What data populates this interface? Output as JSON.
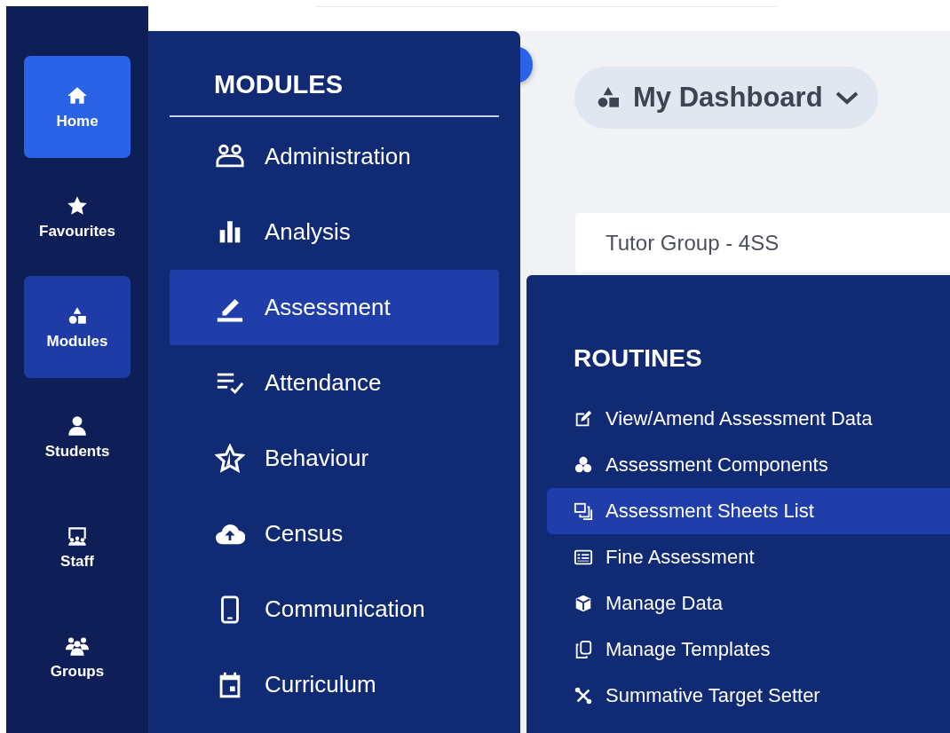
{
  "rail": {
    "items": [
      {
        "label": "Home",
        "selected": false,
        "highlighted": true
      },
      {
        "label": "Favourites",
        "selected": false,
        "highlighted": false
      },
      {
        "label": "Modules",
        "selected": true,
        "highlighted": false
      },
      {
        "label": "Students",
        "selected": false,
        "highlighted": false
      },
      {
        "label": "Staff",
        "selected": false,
        "highlighted": false
      },
      {
        "label": "Groups",
        "selected": false,
        "highlighted": false
      }
    ]
  },
  "modules": {
    "title": "MODULES",
    "items": [
      {
        "label": "Administration",
        "selected": false
      },
      {
        "label": "Analysis",
        "selected": false
      },
      {
        "label": "Assessment",
        "selected": true
      },
      {
        "label": "Attendance",
        "selected": false
      },
      {
        "label": "Behaviour",
        "selected": false
      },
      {
        "label": "Census",
        "selected": false
      },
      {
        "label": "Communication",
        "selected": false
      },
      {
        "label": "Curriculum",
        "selected": false
      }
    ]
  },
  "dashboard": {
    "label": "My Dashboard"
  },
  "group_field": {
    "value": "Tutor Group - 4SS"
  },
  "routines": {
    "title": "ROUTINES",
    "items": [
      {
        "label": "View/Amend Assessment Data",
        "selected": false
      },
      {
        "label": "Assessment Components",
        "selected": false
      },
      {
        "label": "Assessment Sheets List",
        "selected": true
      },
      {
        "label": "Fine Assessment",
        "selected": false
      },
      {
        "label": "Manage Data",
        "selected": false
      },
      {
        "label": "Manage Templates",
        "selected": false
      },
      {
        "label": "Summative Target Setter",
        "selected": false
      }
    ]
  }
}
